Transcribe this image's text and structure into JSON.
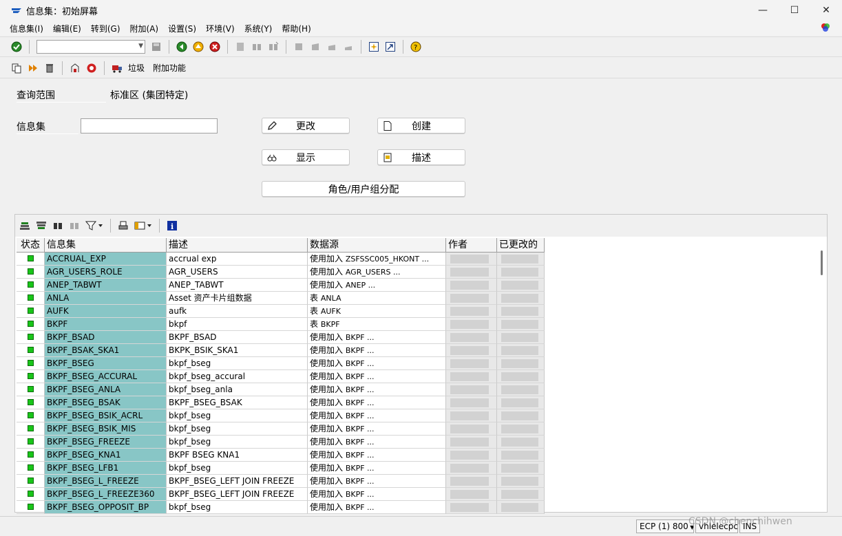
{
  "window": {
    "title": "信息集：初始屏幕",
    "controls": {
      "minimize": "—",
      "maximize": "☐",
      "close": "✕"
    }
  },
  "menu": [
    "信息集(I)",
    "编辑(E)",
    "转到(G)",
    "附加(A)",
    "设置(S)",
    "环境(V)",
    "系统(Y)",
    "帮助(H)"
  ],
  "toolbar2": {
    "trash_label": "垃圾",
    "extras_label": "附加功能"
  },
  "form": {
    "query_area_label": "查询范围",
    "query_area_value": "标准区 (集团特定)",
    "infoset_label": "信息集",
    "infoset_value": ""
  },
  "buttons": {
    "change": "更改",
    "create": "创建",
    "display": "显示",
    "describe": "描述",
    "role_assign": "角色/用户组分配"
  },
  "grid": {
    "columns": [
      "状态",
      "信息集",
      "描述",
      "数据源",
      "作者",
      "已更改的"
    ],
    "rows": [
      {
        "name": "ACCRUAL_EXP",
        "desc": "accrual exp",
        "src_cn": "使用加入",
        "src_en": "ZSFSSC005_HKONT ..."
      },
      {
        "name": "AGR_USERS_ROLE",
        "desc": "AGR_USERS",
        "src_cn": "使用加入",
        "src_en": "AGR_USERS ..."
      },
      {
        "name": "ANEP_TABWT",
        "desc": "ANEP_TABWT",
        "src_cn": "使用加入",
        "src_en": "ANEP ..."
      },
      {
        "name": "ANLA",
        "desc": "Asset 资产卡片组数据",
        "src_cn": "表",
        "src_en": "ANLA"
      },
      {
        "name": "AUFK",
        "desc": "aufk",
        "src_cn": "表",
        "src_en": "AUFK"
      },
      {
        "name": "BKPF",
        "desc": "bkpf",
        "src_cn": "表",
        "src_en": "BKPF"
      },
      {
        "name": "BKPF_BSAD",
        "desc": "BKPF_BSAD",
        "src_cn": "使用加入",
        "src_en": "BKPF ..."
      },
      {
        "name": "BKPF_BSAK_SKA1",
        "desc": "BKPK_BSIK_SKA1",
        "src_cn": "使用加入",
        "src_en": "BKPF ..."
      },
      {
        "name": "BKPF_BSEG",
        "desc": "bkpf_bseg",
        "src_cn": "使用加入",
        "src_en": "BKPF ..."
      },
      {
        "name": "BKPF_BSEG_ACCURAL",
        "desc": "bkpf_bseg_accural",
        "src_cn": "使用加入",
        "src_en": "BKPF ..."
      },
      {
        "name": "BKPF_BSEG_ANLA",
        "desc": "bkpf_bseg_anla",
        "src_cn": "使用加入",
        "src_en": "BKPF ..."
      },
      {
        "name": "BKPF_BSEG_BSAK",
        "desc": "BKPF_BSEG_BSAK",
        "src_cn": "使用加入",
        "src_en": "BKPF ..."
      },
      {
        "name": "BKPF_BSEG_BSIK_ACRL",
        "desc": "bkpf_bseg",
        "src_cn": "使用加入",
        "src_en": "BKPF ..."
      },
      {
        "name": "BKPF_BSEG_BSIK_MIS",
        "desc": "bkpf_bseg",
        "src_cn": "使用加入",
        "src_en": "BKPF ..."
      },
      {
        "name": "BKPF_BSEG_FREEZE",
        "desc": "bkpf_bseg",
        "src_cn": "使用加入",
        "src_en": "BKPF ..."
      },
      {
        "name": "BKPF_BSEG_KNA1",
        "desc": "BKPF BSEG KNA1",
        "src_cn": "使用加入",
        "src_en": "BKPF ..."
      },
      {
        "name": "BKPF_BSEG_LFB1",
        "desc": "bkpf_bseg",
        "src_cn": "使用加入",
        "src_en": "BKPF ..."
      },
      {
        "name": "BKPF_BSEG_L_FREEZE",
        "desc": "BKPF_BSEG_LEFT JOIN FREEZE",
        "src_cn": "使用加入",
        "src_en": "BKPF ..."
      },
      {
        "name": "BKPF_BSEG_L_FREEZE360",
        "desc": "BKPF_BSEG_LEFT JOIN FREEZE",
        "src_cn": "使用加入",
        "src_en": "BKPF ..."
      },
      {
        "name": "BKPF_BSEG_OPPOSIT_BP",
        "desc": "bkpf_bseg",
        "src_cn": "使用加入",
        "src_en": "BKPF ..."
      }
    ]
  },
  "statusbar": {
    "system": "ECP (1) 800",
    "server": "vhlelecpci",
    "mode": "INS"
  },
  "watermark": "CSDN @chenchihwen",
  "colors": {
    "key_column": "#88c6c6",
    "led_green": "#19c619"
  }
}
